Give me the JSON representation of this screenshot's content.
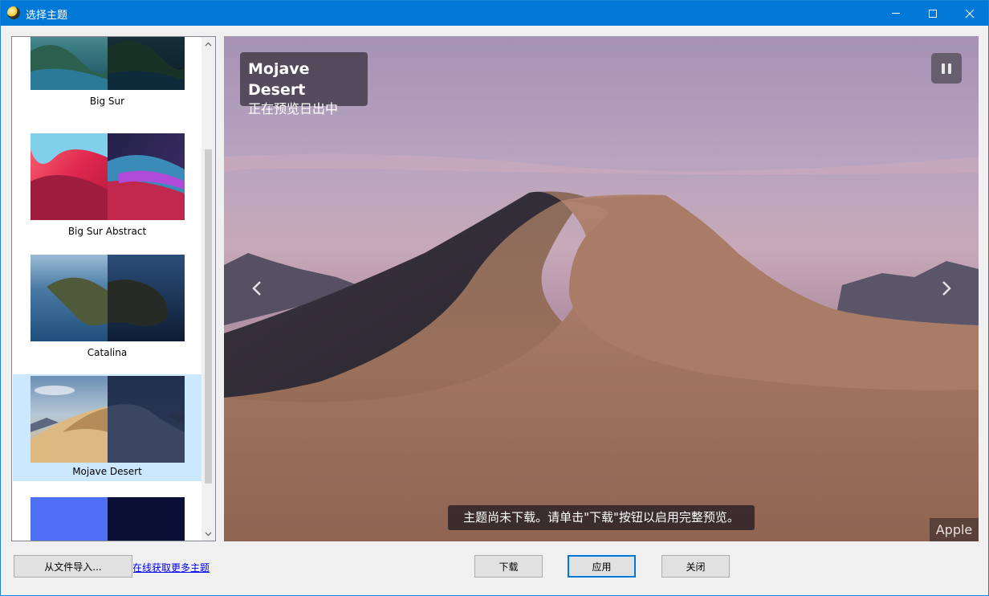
{
  "window": {
    "title": "选择主题",
    "accent_color": "#0078d7",
    "controls": {
      "minimize_icon": "minimize-icon",
      "maximize_icon": "maximize-icon",
      "close_icon": "close-icon"
    }
  },
  "theme_list": {
    "items": [
      {
        "label": "Big Sur",
        "selected": false,
        "colors": [
          "#2f6f79",
          "#0f2a34"
        ]
      },
      {
        "label": "Big Sur Abstract",
        "selected": false,
        "colors": [
          "#e0306a",
          "#3a2a7a"
        ]
      },
      {
        "label": "Catalina",
        "selected": false,
        "colors": [
          "#3f6f96",
          "#1a2a44"
        ]
      },
      {
        "label": "Mojave Desert",
        "selected": true,
        "colors": [
          "#d9b883",
          "#2c3552"
        ]
      },
      {
        "label": "",
        "selected": false,
        "colors": [
          "#4e6ff5",
          "#0a1033"
        ]
      }
    ],
    "selected_color": "#cce8ff"
  },
  "preview": {
    "theme_name": "Mojave Desert",
    "status": "正在预览日出中",
    "notice": "主题尚未下载。请单击\"下载\"按钮以启用完整预览。",
    "credit": "Apple",
    "pause_icon": "pause-icon",
    "prev_icon": "chevron-left-icon",
    "next_icon": "chevron-right-icon"
  },
  "footer": {
    "import_label": "从文件导入...",
    "more_link": "在线获取更多主题",
    "download_label": "下载",
    "apply_label": "应用",
    "close_label": "关闭"
  }
}
